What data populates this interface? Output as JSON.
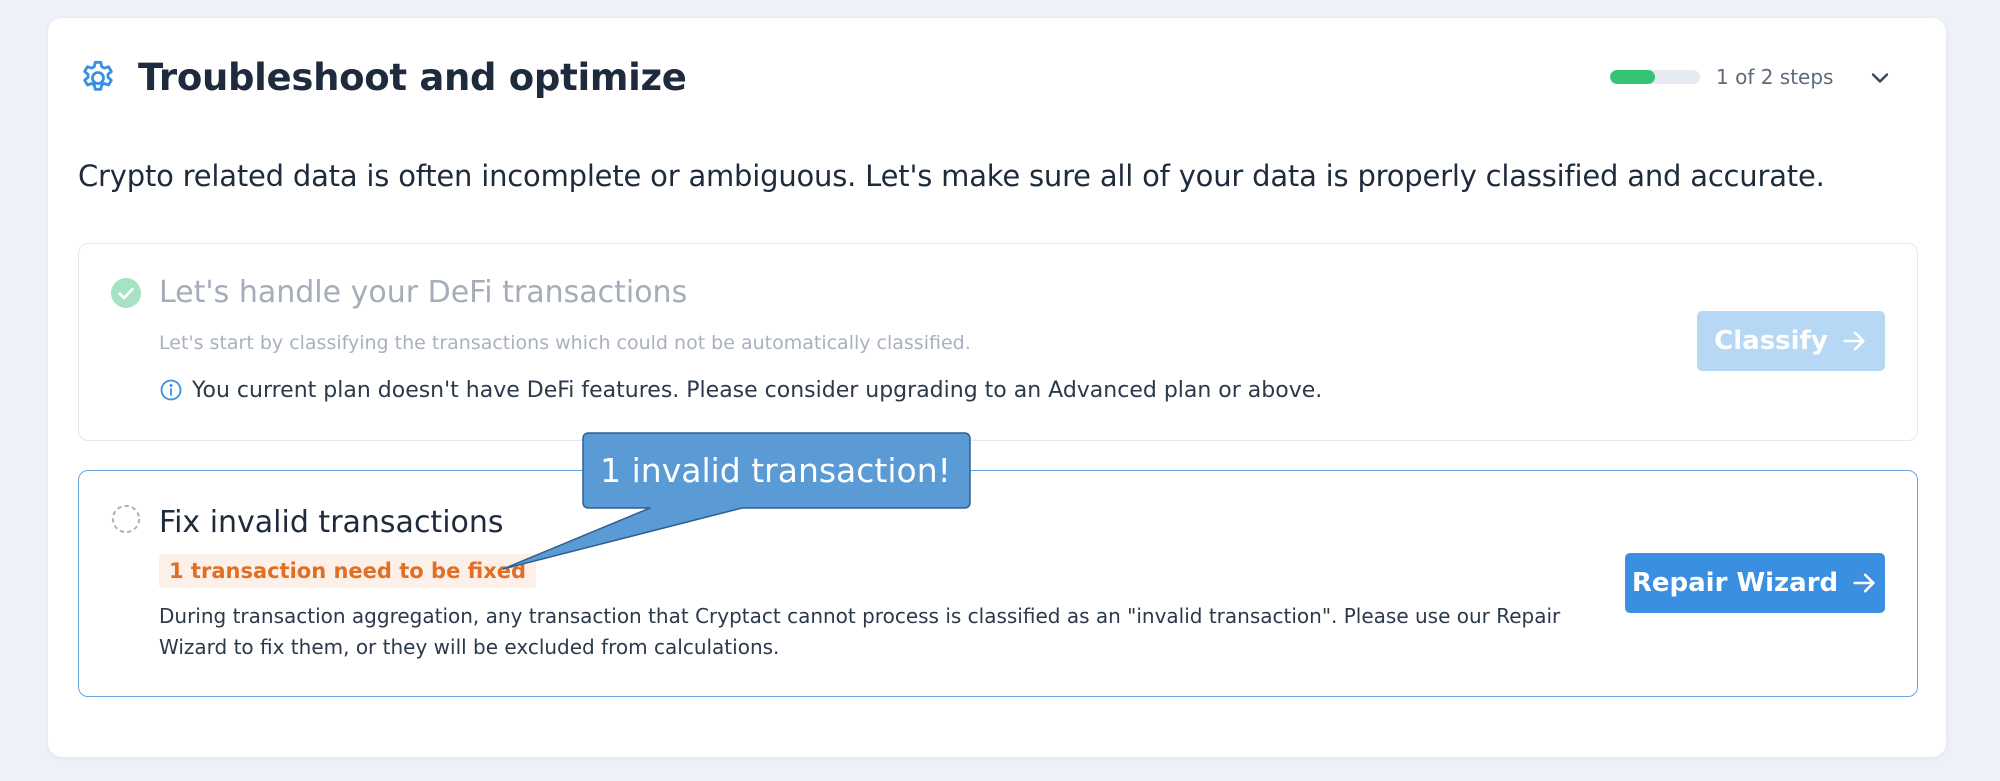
{
  "header": {
    "title": "Troubleshoot and optimize",
    "icon": "gear-icon",
    "progress": {
      "label": "1 of 2 steps",
      "completed": 1,
      "total": 2,
      "fill_color": "#34c474"
    },
    "subtitle": "Crypto related data is often incomplete or ambiguous. Let's make sure all of your data is properly classified and accurate."
  },
  "steps": [
    {
      "status": "done",
      "icon": "check-circle-icon",
      "title": "Let's handle your DeFi transactions",
      "description": "Let's start by classifying the transactions which could not be automatically classified.",
      "notice_icon": "info-icon",
      "notice": "You current plan doesn't have DeFi features. Please consider upgrading to an Advanced plan or above.",
      "button_label": "Classify",
      "button_state": "disabled"
    },
    {
      "status": "pending",
      "icon": "dashed-circle-icon",
      "title": "Fix invalid transactions",
      "badge": "1 transaction need to be fixed",
      "description": "During transaction aggregation, any transaction that Cryptact cannot process is classified as an \"invalid transaction\". Please use our Repair Wizard to fix them, or they will be excluded from calculations.",
      "button_label": "Repair Wizard",
      "button_state": "enabled"
    }
  ],
  "callout": {
    "text": "1 invalid transaction!",
    "fill_color": "#5b9bd5"
  },
  "colors": {
    "accent": "#3b8fe0",
    "success": "#34c474",
    "warning": "#e16e25"
  }
}
